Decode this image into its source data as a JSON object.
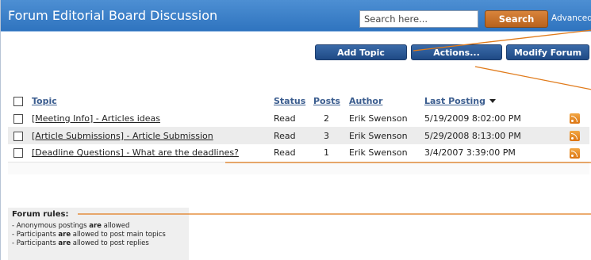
{
  "header": {
    "title": "Forum Editorial Board Discussion",
    "search_placeholder": "Search here...",
    "search_button": "Search",
    "advanced_link": "Advanced"
  },
  "toolbar": {
    "add_topic": "Add Topic",
    "actions": "Actions...",
    "modify_forum": "Modify Forum"
  },
  "table": {
    "headers": {
      "topic": "Topic",
      "status": "Status",
      "posts": "Posts",
      "author": "Author",
      "last_posting": "Last Posting"
    },
    "rows": [
      {
        "topic": "[Meeting Info] - Articles ideas",
        "status": "Read",
        "posts": "2",
        "author": "Erik Swenson",
        "last_posting": "5/19/2009 8:02:00 PM"
      },
      {
        "topic": "[Article Submissions] - Article Submission",
        "status": "Read",
        "posts": "3",
        "author": "Erik Swenson",
        "last_posting": "5/29/2008 8:13:00 PM"
      },
      {
        "topic": "[Deadline Questions] - What are the deadlines?",
        "status": "Read",
        "posts": "1",
        "author": "Erik Swenson",
        "last_posting": "3/4/2007 3:39:00 PM"
      }
    ]
  },
  "rules": {
    "title": "Forum rules:",
    "lines": [
      {
        "prefix": "- Anonymous postings ",
        "bold": "are",
        "suffix": " allowed"
      },
      {
        "prefix": "- Participants ",
        "bold": "are",
        "suffix": " allowed to post main topics"
      },
      {
        "prefix": "- Participants ",
        "bold": "are",
        "suffix": " allowed to post replies"
      }
    ]
  },
  "colors": {
    "header_blue": "#3a7fc9",
    "button_navy": "#2a5592",
    "search_orange": "#c9722a",
    "annotation_orange": "#e07a1a",
    "rss_orange": "#e88a22"
  },
  "icons": [
    "rss-icon",
    "sort-desc-arrow-icon",
    "checkbox"
  ]
}
